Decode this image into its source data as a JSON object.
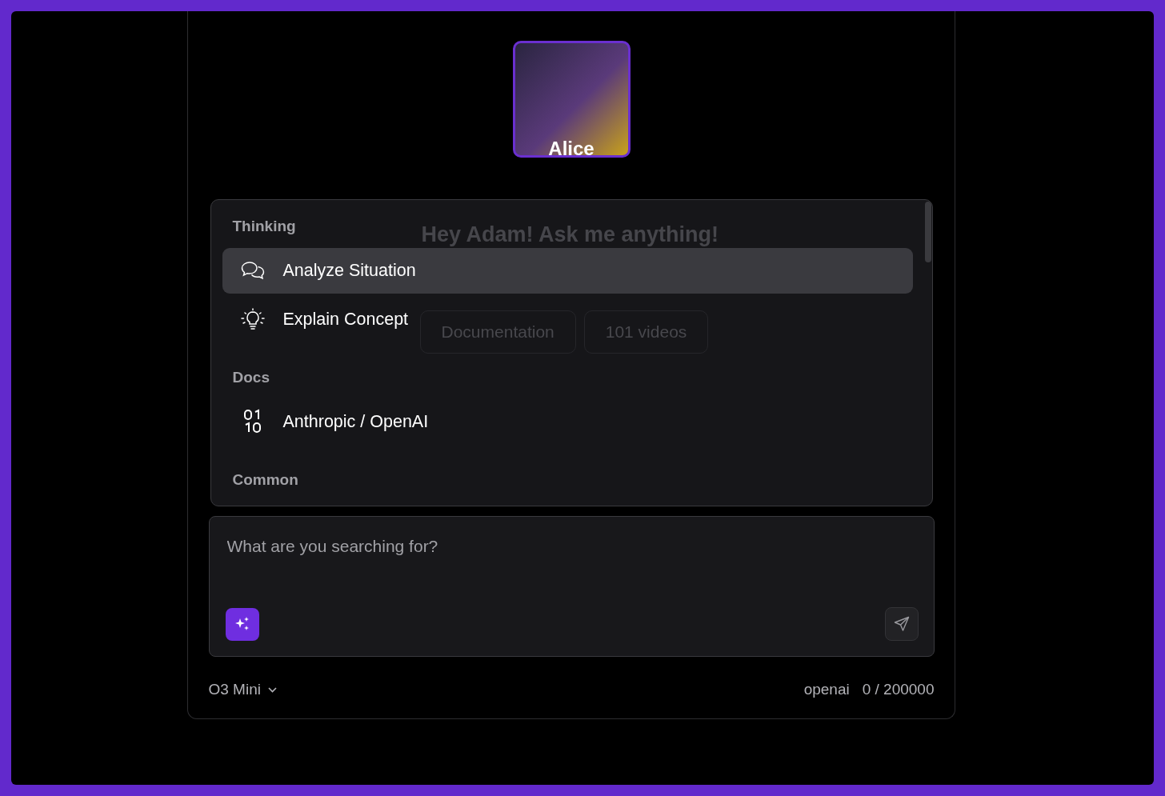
{
  "assistant": {
    "name": "Alice"
  },
  "background": {
    "greeting": "Hey Adam! Ask me anything!",
    "chips": [
      "Documentation",
      "101 videos"
    ]
  },
  "menu": {
    "groups": [
      {
        "title": "Thinking",
        "items": [
          {
            "label": "Analyze Situation",
            "selected": true
          },
          {
            "label": "Explain Concept",
            "selected": false
          }
        ]
      },
      {
        "title": "Docs",
        "items": [
          {
            "label": "Anthropic / OpenAI",
            "selected": false
          }
        ]
      },
      {
        "title": "Common"
      }
    ]
  },
  "composer": {
    "placeholder": "What are you searching for?"
  },
  "footer": {
    "model": "O3 Mini",
    "provider": "openai",
    "tokens": "0 / 200000"
  }
}
